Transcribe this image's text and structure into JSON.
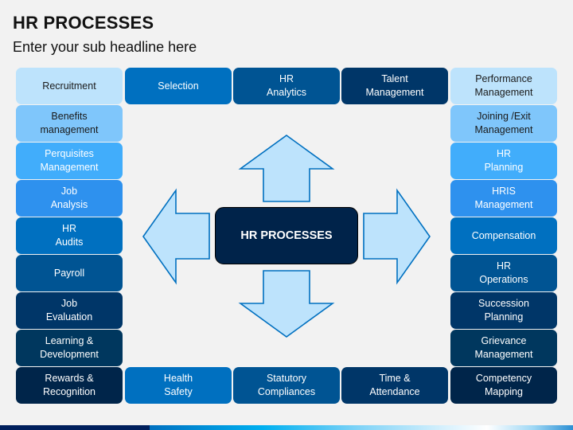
{
  "header": {
    "title": "HR PROCESSES",
    "subtitle": "Enter your sub headline here"
  },
  "center": {
    "label": "HR PROCESSES",
    "arrows": [
      "up",
      "down",
      "left",
      "right"
    ]
  },
  "left_column": [
    {
      "label": "Recruitment",
      "color": "#BDE3FC"
    },
    {
      "label": "Benefits\nmanagement",
      "color": "#7FC6FB"
    },
    {
      "label": "Perquisites\nManagement",
      "color": "#41ADFB"
    },
    {
      "label": "Job\nAnalysis",
      "color": "#2E91EE"
    },
    {
      "label": "HR\nAudits",
      "color": "#0070C0"
    },
    {
      "label": "Payroll",
      "color": "#005493"
    },
    {
      "label": "Job\nEvaluation",
      "color": "#003668"
    },
    {
      "label": "Learning &\nDevelopment",
      "color": "#00375E"
    },
    {
      "label": "Rewards &\nRecognition",
      "color": "#00254A"
    }
  ],
  "top_row": [
    {
      "label": "Selection",
      "color": "#0070C0"
    },
    {
      "label": "HR\nAnalytics",
      "color": "#005493"
    },
    {
      "label": "Talent\nManagement",
      "color": "#003668"
    }
  ],
  "right_column": [
    {
      "label": "Performance\nManagement",
      "color": "#BDE3FC"
    },
    {
      "label": "Joining /Exit\nManagement",
      "color": "#7FC6FB"
    },
    {
      "label": "HR\nPlanning",
      "color": "#41ADFB"
    },
    {
      "label": "HRIS\nManagement",
      "color": "#2E91EE"
    },
    {
      "label": "Compensation",
      "color": "#0070C0"
    },
    {
      "label": "HR\nOperations",
      "color": "#005493"
    },
    {
      "label": "Succession\nPlanning",
      "color": "#003668"
    },
    {
      "label": "Grievance\nManagement",
      "color": "#00375E"
    },
    {
      "label": "Competency\nMapping",
      "color": "#00254A"
    }
  ],
  "bottom_row": [
    {
      "label": "Health\nSafety",
      "color": "#0070C0"
    },
    {
      "label": "Statutory\nCompliances",
      "color": "#005493"
    },
    {
      "label": "Time &\nAttendance",
      "color": "#003668"
    }
  ],
  "colors": {
    "background": "#F2F2F2",
    "center_fill": "#00234A",
    "arrow_fill": "#BDE3FC",
    "arrow_stroke": "#0070C0"
  }
}
